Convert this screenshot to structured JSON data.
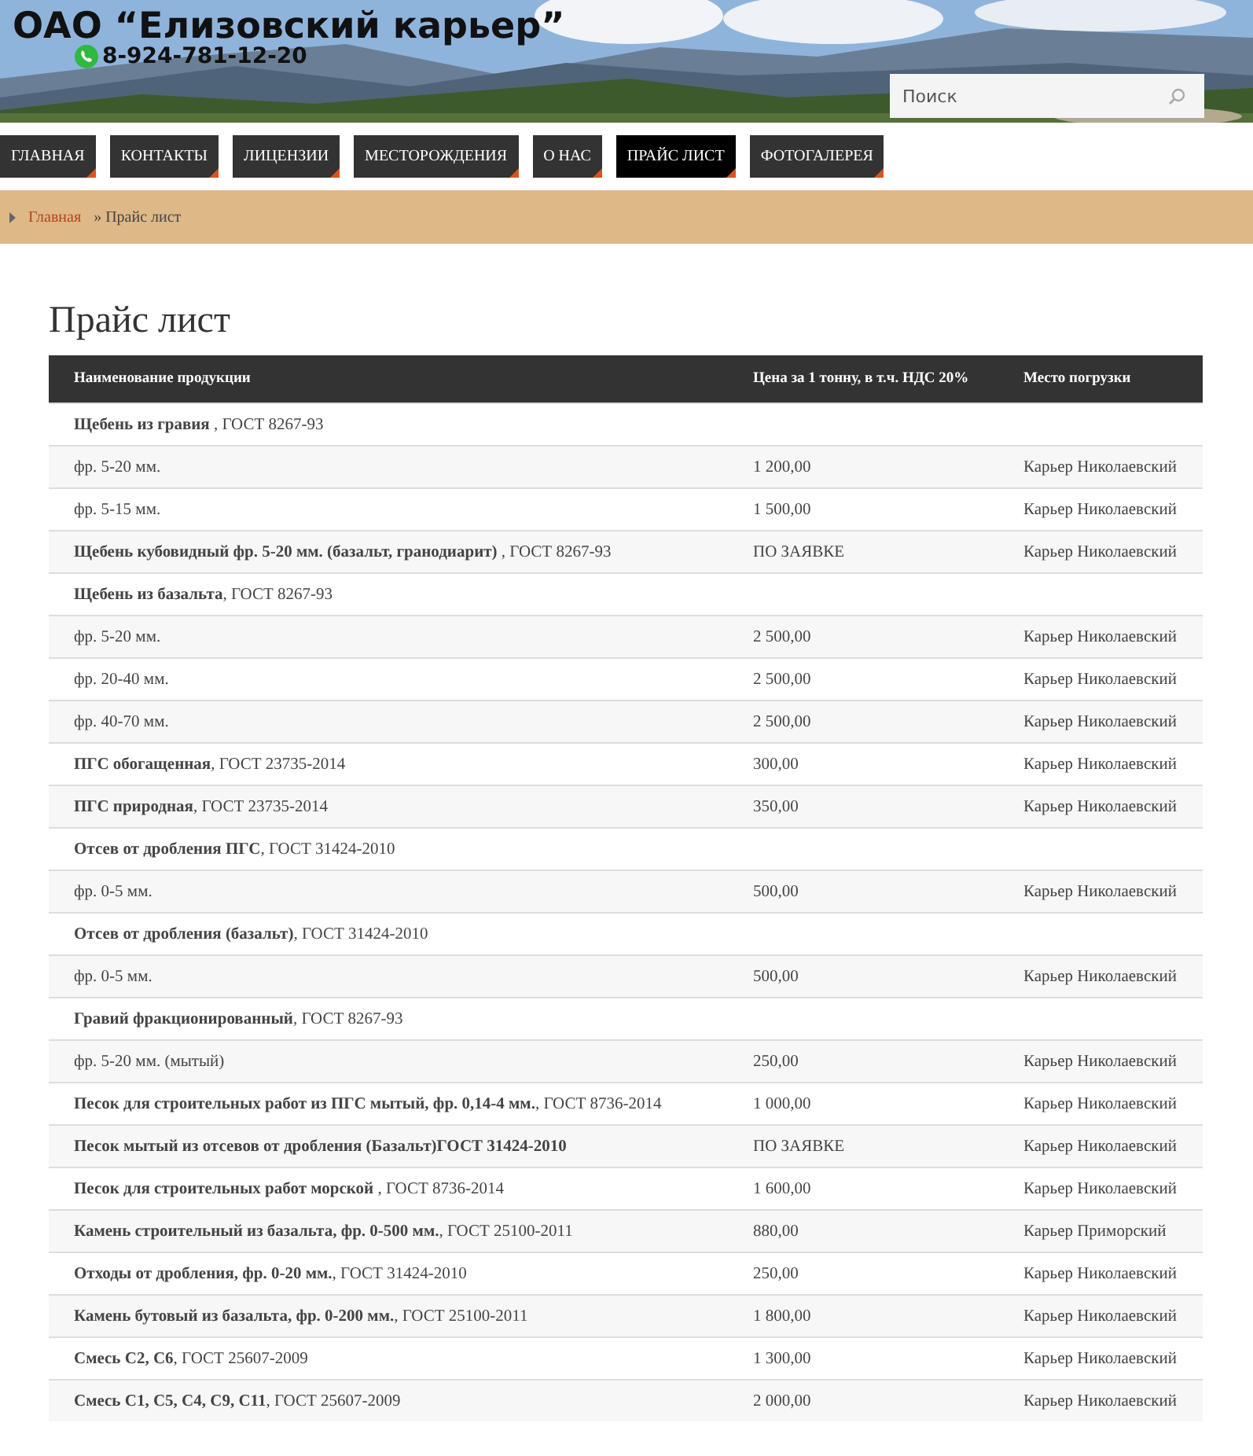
{
  "header": {
    "title": "ОАО “Елизовский карьер”",
    "phone": "8-924-781-12-20",
    "search": {
      "placeholder": "Поиск"
    }
  },
  "nav": [
    {
      "label": "ГЛАВНАЯ",
      "selected": false
    },
    {
      "label": "КОНТАКТЫ",
      "selected": false
    },
    {
      "label": "ЛИЦЕНЗИИ",
      "selected": false
    },
    {
      "label": "МЕСТОРОЖДЕНИЯ",
      "selected": false
    },
    {
      "label": "О НАС",
      "selected": false
    },
    {
      "label": "ПРАЙС ЛИСТ",
      "selected": true
    },
    {
      "label": "ФОТОГАЛЕРЕЯ",
      "selected": false
    }
  ],
  "breadcrumb": {
    "home": "Главная",
    "current": "» Прайс лист"
  },
  "page_title": "Прайс лист",
  "table": {
    "columns": [
      "Наименование продукции",
      "Цена за 1 тонну, в т.ч. НДС 20%",
      "Место погрузки"
    ],
    "rows": [
      [
        "**Щебень из гравия** , ГОСТ 8267-93",
        "",
        ""
      ],
      [
        "фр. 5-20 мм.",
        "1 200,00",
        "Карьер Николаевский"
      ],
      [
        "фр. 5-15 мм.",
        "1 500,00",
        "Карьер Николаевский"
      ],
      [
        "**Щебень кубовидный фр. 5-20 мм. (базальт, гранодиарит)** , ГОСТ 8267-93",
        "ПО ЗАЯВКЕ",
        "Карьер Николаевский"
      ],
      [
        "**Щебень из базальта**, ГОСТ 8267-93",
        "",
        ""
      ],
      [
        "фр. 5-20 мм.",
        "2 500,00",
        "Карьер Николаевский"
      ],
      [
        "фр. 20-40 мм.",
        "2 500,00",
        "Карьер Николаевский"
      ],
      [
        "фр. 40-70 мм.",
        "2 500,00",
        "Карьер Николаевский"
      ],
      [
        "**ПГС обогащенная**, ГОСТ 23735-2014",
        "300,00",
        "Карьер Николаевский"
      ],
      [
        "**ПГС природная**, ГОСТ 23735-2014",
        "350,00",
        "Карьер Николаевский"
      ],
      [
        "**Отсев от дробления ПГС**, ГОСТ 31424-2010",
        "",
        ""
      ],
      [
        "фр. 0-5 мм.",
        "500,00",
        "Карьер Николаевский"
      ],
      [
        "**Отсев от дробления (базальт)**, ГОСТ 31424-2010",
        "",
        ""
      ],
      [
        "фр. 0-5 мм.",
        "500,00",
        "Карьер Николаевский"
      ],
      [
        "**Гравий фракционированный**, ГОСТ 8267-93",
        "",
        ""
      ],
      [
        "фр. 5-20 мм. (мытый)",
        "250,00",
        "Карьер Николаевский"
      ],
      [
        "**Песок для строительных работ из ПГС мытый, фр. 0,14-4 мм.**, ГОСТ 8736-2014",
        "1 000,00",
        "Карьер Николаевский"
      ],
      [
        "**Песок мытый из отсевов от дробления (Базальт)ГОСТ 31424-2010**",
        "ПО ЗАЯВКЕ",
        "Карьер Николаевский"
      ],
      [
        "**Песок для строительных работ морской** , ГОСТ 8736-2014",
        "1 600,00",
        "Карьер Николаевский"
      ],
      [
        "**Камень строительный из базальта, фр. 0-500 мм.**, ГОСТ 25100-2011",
        "880,00",
        "Карьер Приморский"
      ],
      [
        "**Отходы от дробления, фр. 0-20 мм.**, ГОСТ 31424-2010",
        "250,00",
        "Карьер Николаевский"
      ],
      [
        "**Камень бутовый из базальта, фр. 0-200 мм.**, ГОСТ 25100-2011",
        "1 800,00",
        "Карьер Николаевский"
      ],
      [
        "**Смесь С2, С6**, ГОСТ 25607-2009",
        "1 300,00",
        "Карьер Николаевский"
      ],
      [
        "**Смесь С1, С5, С4, С9, С11**, ГОСТ 25607-2009",
        "2 000,00",
        "Карьер Николаевский"
      ]
    ]
  }
}
